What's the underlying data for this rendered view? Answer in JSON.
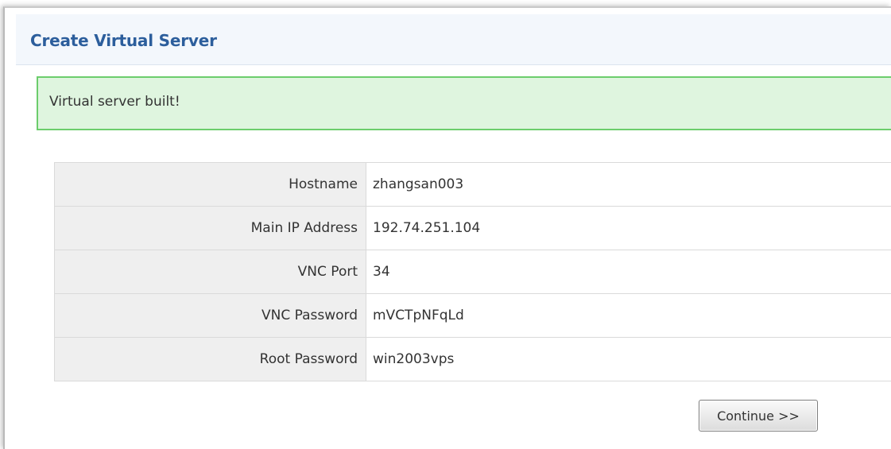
{
  "panel": {
    "title": "Create Virtual Server"
  },
  "alert": {
    "message": "Virtual server built!",
    "color_bg": "#dff5df",
    "color_border": "#6ccd6c"
  },
  "details": {
    "rows": [
      {
        "label": "Hostname",
        "value": "zhangsan003"
      },
      {
        "label": "Main IP Address",
        "value": "192.74.251.104"
      },
      {
        "label": "VNC Port",
        "value": "34"
      },
      {
        "label": "VNC Password",
        "value": "mVCTpNFqLd"
      },
      {
        "label": "Root Password",
        "value": "win2003vps"
      }
    ]
  },
  "actions": {
    "continue_label": "Continue >>"
  },
  "colors": {
    "title": "#2c5e9c",
    "header_bg": "#f3f7fc",
    "label_bg": "#efefef"
  }
}
